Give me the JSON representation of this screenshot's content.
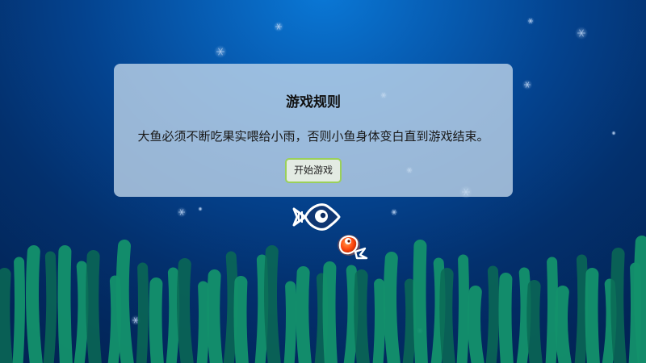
{
  "dialog": {
    "title": "游戏规则",
    "text": "大鱼必须不断吃果实喂给小雨，否则小鱼身体变白直到游戏结束。",
    "start_label": "开始游戏"
  },
  "colors": {
    "water_top": "#0a78d6",
    "water_bottom": "#022456",
    "seaweed_light": "#13916b",
    "seaweed_dark": "#0a6a55",
    "baby_fish": "#ff5a1a",
    "button_border": "#9ad05a"
  },
  "sprites": {
    "big_fish": "big-fish-white",
    "baby_fish": "baby-fish-orange",
    "particles": "snowflake-dust"
  }
}
